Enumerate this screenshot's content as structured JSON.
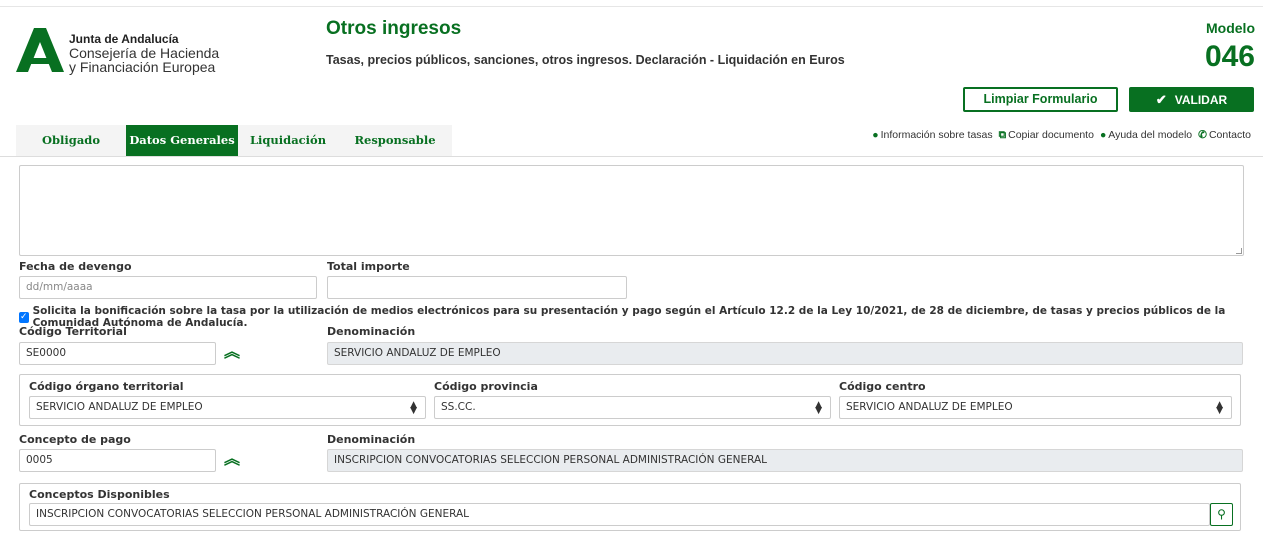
{
  "header": {
    "org_line1": "Junta de Andalucía",
    "org_line2": "Consejería de Hacienda",
    "org_line3": "y Financiación Europea",
    "title": "Otros ingresos",
    "subtitle": "Tasas, precios públicos, sanciones, otros ingresos. Declaración - Liquidación en Euros",
    "modelo_label": "Modelo",
    "modelo_number": "046"
  },
  "actions": {
    "clear_label": "Limpiar Formulario",
    "validate_label": "VALIDAR"
  },
  "tabs": [
    {
      "label": "Obligado",
      "active": false
    },
    {
      "label": "Datos Generales",
      "active": true
    },
    {
      "label": "Liquidación",
      "active": false
    },
    {
      "label": "Responsable",
      "active": false
    }
  ],
  "links": {
    "info": "Información sobre tasas",
    "copy": "Copiar documento",
    "help": "Ayuda del modelo",
    "contact": "Contacto"
  },
  "form": {
    "fecha_devengo_label": "Fecha de devengo",
    "fecha_devengo_placeholder": "dd/mm/aaaa",
    "total_importe_label": "Total importe",
    "total_importe_value": "",
    "bonificacion_text": "Solicita la bonificación sobre la tasa por la utilización de medios electrónicos para su presentación y pago según el Artículo 12.2 de la Ley 10/2021, de 28 de diciembre, de tasas y precios públicos de la Comunidad Autónoma de Andalucía.",
    "bonificacion_checked": true,
    "codigo_territorial_label": "Código Territorial",
    "codigo_territorial_value": "SE0000",
    "denominacion_label": "Denominación",
    "denominacion_territorial_value": "SERVICIO ANDALUZ DE EMPLEO",
    "organo_label": "Código órgano territorial",
    "organo_value": "SERVICIO ANDALUZ DE EMPLEO",
    "provincia_label": "Código provincia",
    "provincia_value": "SS.CC.",
    "centro_label": "Código centro",
    "centro_value": "SERVICIO ANDALUZ DE EMPLEO",
    "concepto_label": "Concepto de pago",
    "concepto_value": "0005",
    "denominacion_concepto_label": "Denominación",
    "denominacion_concepto_value": "INSCRIPCION CONVOCATORIAS SELECCION PERSONAL ADMINISTRACIÓN GENERAL",
    "conceptos_label": "Conceptos Disponibles",
    "conceptos_value": "INSCRIPCION CONVOCATORIAS SELECCION PERSONAL ADMINISTRACIÓN GENERAL"
  },
  "colors": {
    "brand_green": "#087021",
    "checkbox_blue": "#0075ff"
  }
}
